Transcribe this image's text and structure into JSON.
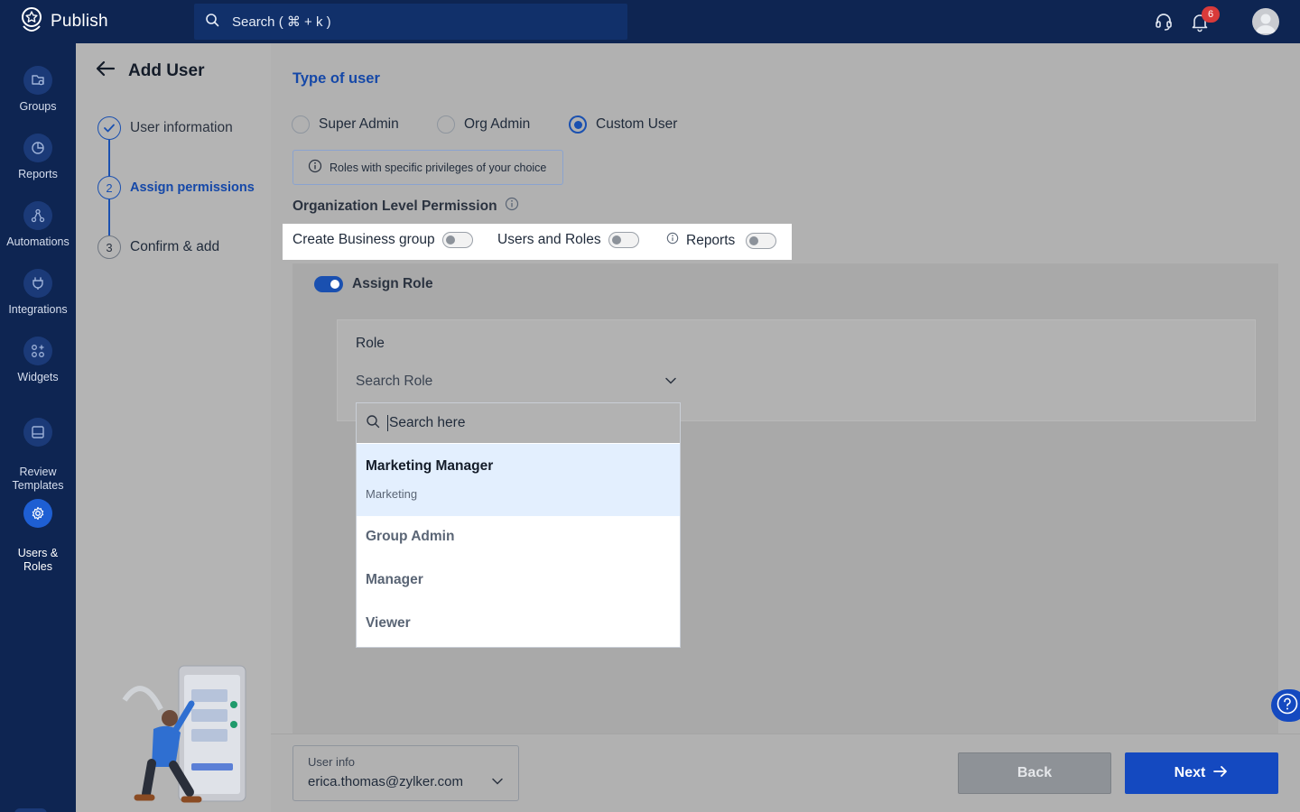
{
  "app": {
    "name": "Publish"
  },
  "search": {
    "placeholder": "Search ( ⌘ + k )"
  },
  "notifications": {
    "count": "6"
  },
  "nav": {
    "items": [
      {
        "label": "Groups",
        "icon": "groups-icon"
      },
      {
        "label": "Reports",
        "icon": "reports-icon"
      },
      {
        "label": "Automations",
        "icon": "automations-icon"
      },
      {
        "label": "Integrations",
        "icon": "integrations-icon"
      },
      {
        "label": "Widgets",
        "icon": "widgets-icon"
      },
      {
        "label": "Review\nTemplates",
        "icon": "templates-icon"
      },
      {
        "label": "Users &\nRoles",
        "icon": "gear-icon",
        "active": true
      }
    ]
  },
  "page": {
    "title": "Add User"
  },
  "steps": [
    {
      "label": "User information",
      "state": "done"
    },
    {
      "number": "2",
      "label": "Assign permissions",
      "state": "current"
    },
    {
      "number": "3",
      "label": "Confirm & add",
      "state": "pending"
    }
  ],
  "user_type": {
    "title": "Type of user",
    "options": [
      "Super Admin",
      "Org Admin",
      "Custom User"
    ],
    "selected": "Custom User",
    "note": "Roles with specific privileges of your choice"
  },
  "org_permissions": {
    "title": "Organization Level Permission",
    "items": [
      {
        "label": "Create Business group",
        "enabled": false
      },
      {
        "label": "Users and Roles",
        "enabled": false
      },
      {
        "label": "Reports",
        "enabled": false
      }
    ]
  },
  "assign_role": {
    "label": "Assign Role",
    "enabled": true,
    "role_label": "Role",
    "select_placeholder": "Search Role",
    "dropdown": {
      "search_placeholder": "Search here",
      "options": [
        {
          "name": "Marketing Manager",
          "group": "Marketing"
        },
        {
          "name": "Group Admin"
        },
        {
          "name": "Manager"
        },
        {
          "name": "Viewer"
        }
      ]
    }
  },
  "footer": {
    "user_info_label": "User info",
    "user_info_value": "erica.thomas@zylker.com",
    "back_label": "Back",
    "next_label": "Next"
  },
  "colors": {
    "nav_bg": "#0e2552",
    "accent": "#1449c0",
    "badge": "#d83a3a",
    "selected_option_bg": "#e3effe"
  }
}
